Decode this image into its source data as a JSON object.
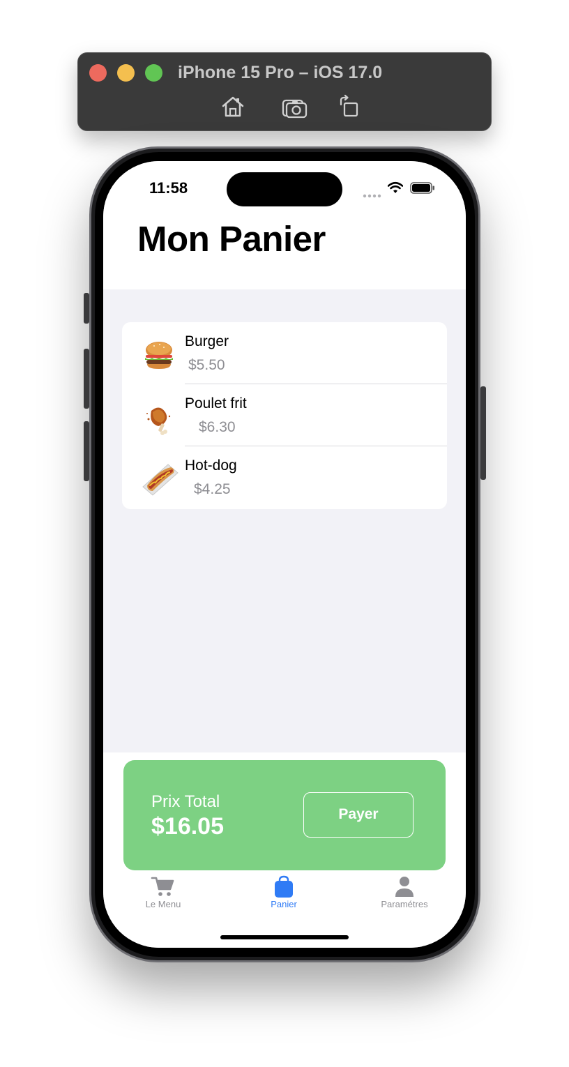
{
  "simulator": {
    "title": "iPhone 15 Pro – iOS 17.0",
    "buttons": [
      "home-icon",
      "screenshot-icon",
      "rotate-icon"
    ]
  },
  "status_bar": {
    "time": "11:58"
  },
  "header": {
    "title": "Mon Panier"
  },
  "cart": {
    "items": [
      {
        "name": "Burger",
        "price": "$5.50",
        "icon": "burger-image"
      },
      {
        "name": "Poulet frit",
        "price": "$6.30",
        "icon": "fried-chicken-image"
      },
      {
        "name": "Hot-dog",
        "price": "$4.25",
        "icon": "hot-dog-image"
      }
    ]
  },
  "total": {
    "label": "Prix Total",
    "value": "$16.05",
    "pay_label": "Payer"
  },
  "tab_bar": {
    "tabs": [
      {
        "label": "Le Menu",
        "icon": "cart-icon",
        "active": false
      },
      {
        "label": "Panier",
        "icon": "bag-icon",
        "active": true
      },
      {
        "label": "Paramétres",
        "icon": "person-icon",
        "active": false
      }
    ]
  },
  "colors": {
    "accent": "#2f7bf5",
    "total_card": "#7dd183",
    "background_grouped": "#f2f2f7",
    "secondary_text": "#8e8e93"
  }
}
